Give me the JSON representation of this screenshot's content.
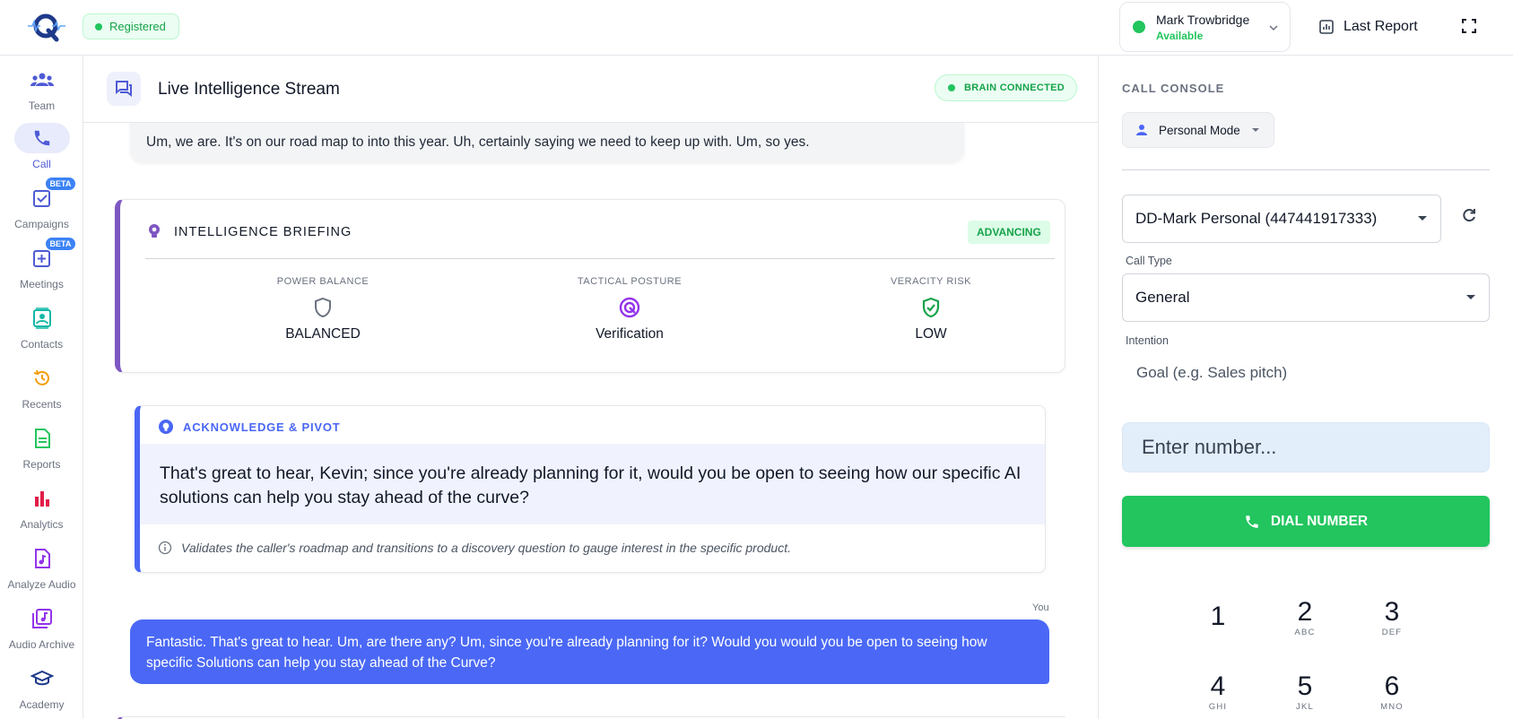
{
  "topbar": {
    "registered_label": "Registered",
    "user_name": "Mark Trowbridge",
    "user_status": "Available",
    "last_report_label": "Last Report"
  },
  "sidebar": {
    "items": [
      {
        "label": "Team",
        "icon": "team-icon",
        "active": false
      },
      {
        "label": "Call",
        "icon": "phone-icon",
        "active": true
      },
      {
        "label": "Campaigns",
        "icon": "campaign-check-icon",
        "badge": "BETA"
      },
      {
        "label": "Meetings",
        "icon": "meeting-add-icon",
        "badge": "BETA"
      },
      {
        "label": "Contacts",
        "icon": "contacts-icon"
      },
      {
        "label": "Recents",
        "icon": "history-icon"
      },
      {
        "label": "Reports",
        "icon": "report-document-icon"
      },
      {
        "label": "Analytics",
        "icon": "bar-chart-icon"
      },
      {
        "label": "Analyze Audio",
        "icon": "audio-file-icon"
      },
      {
        "label": "Audio Archive",
        "icon": "library-music-icon"
      },
      {
        "label": "Academy",
        "icon": "graduation-cap-icon"
      }
    ]
  },
  "stream": {
    "title": "Live Intelligence Stream",
    "brain_status": "BRAIN CONNECTED",
    "caller_message": "Um, we are. It's on our road map to into this year. Uh, certainly saying we need to keep up with. Um, so yes.",
    "briefing": {
      "title": "INTELLIGENCE BRIEFING",
      "badge": "ADVANCING",
      "metrics": [
        {
          "label": "POWER BALANCE",
          "value": "BALANCED",
          "icon": "shield-outline-icon"
        },
        {
          "label": "TACTICAL POSTURE",
          "value": "Verification",
          "icon": "target-icon"
        },
        {
          "label": "VERACITY RISK",
          "value": "LOW",
          "icon": "shield-check-icon"
        }
      ]
    },
    "pivot": {
      "title": "ACKNOWLEDGE & PIVOT",
      "suggestion": "That's great to hear, Kevin; since you're already planning for it, would you be open to seeing how our specific AI solutions can help you stay ahead of the curve?",
      "note": "Validates the caller's roadmap and transitions to a discovery question to gauge interest in the specific product."
    },
    "you_label": "You",
    "user_message": "Fantastic. That's great to hear. Um, are there any? Um, since you're already planning for it? Would you would you be open to seeing how specific Solutions can help you stay ahead of the Curve?"
  },
  "console": {
    "label": "CALL CONSOLE",
    "mode": "Personal Mode",
    "line_select": "DD-Mark Personal (447441917333)",
    "call_type_label": "Call Type",
    "call_type_value": "General",
    "intention_label": "Intention",
    "intention_placeholder": "Goal (e.g. Sales pitch)",
    "number_placeholder": "Enter number...",
    "dial_label": "DIAL NUMBER",
    "keypad": [
      {
        "num": "1",
        "sub": ""
      },
      {
        "num": "2",
        "sub": "ABC"
      },
      {
        "num": "3",
        "sub": "DEF"
      },
      {
        "num": "4",
        "sub": "GHI"
      },
      {
        "num": "5",
        "sub": "JKL"
      },
      {
        "num": "6",
        "sub": "MNO"
      }
    ]
  },
  "colors": {
    "accent_blue": "#4a68f5",
    "brand_purple": "#7e57c2",
    "success_green": "#22c55e"
  }
}
